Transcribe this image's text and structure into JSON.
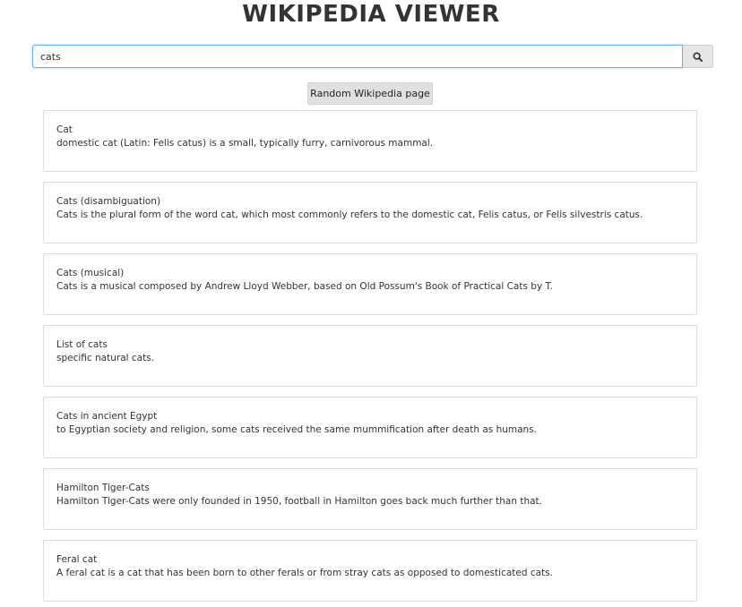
{
  "header": {
    "title": "WIKIPEDIA VIEWER"
  },
  "search": {
    "value": "cats",
    "button_icon": "search-icon"
  },
  "random_button": {
    "label": "Random Wikipedia page"
  },
  "results": [
    {
      "title": "Cat",
      "snippet": "domestic cat (Latin: Felis catus) is a small, typically furry, carnivorous mammal."
    },
    {
      "title": "Cats (disambiguation)",
      "snippet": "Cats is the plural form of the word cat, which most commonly refers to the domestic cat, Felis catus, or Felis silvestris catus."
    },
    {
      "title": "Cats (musical)",
      "snippet": "Cats is a musical composed by Andrew Lloyd Webber, based on Old Possum's Book of Practical Cats by T."
    },
    {
      "title": "List of cats",
      "snippet": "specific natural cats."
    },
    {
      "title": "Cats in ancient Egypt",
      "snippet": "to Egyptian society and religion, some cats received the same mummification after death as humans."
    },
    {
      "title": "Hamilton Tiger-Cats",
      "snippet": "Hamilton Tiger-Cats were only founded in 1950, football in Hamilton goes back much further than that."
    },
    {
      "title": "Feral cat",
      "snippet": "A feral cat is a cat that has been born to other ferals or from stray cats as opposed to domesticated cats."
    }
  ]
}
